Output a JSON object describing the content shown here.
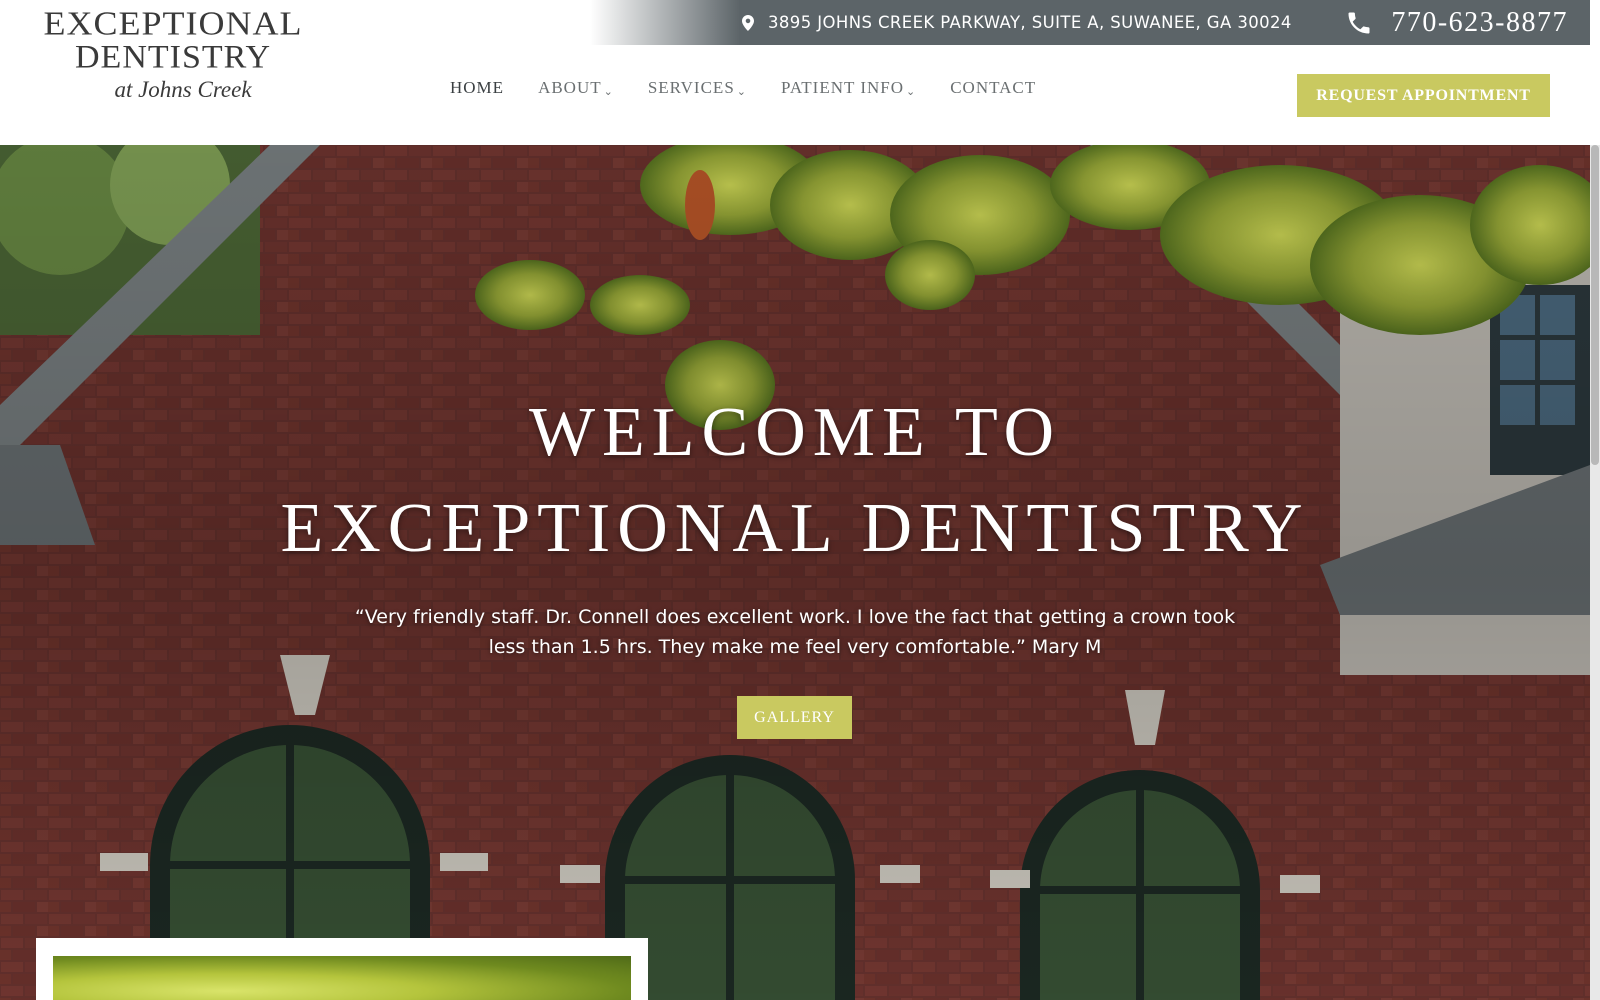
{
  "topbar": {
    "address": "3895 JOHNS CREEK PARKWAY, SUITE A, SUWANEE, GA 30024",
    "phone": "770-623-8877",
    "location_icon": "map-pin-icon",
    "phone_icon": "phone-icon"
  },
  "logo": {
    "line1": "EXCEPTIONAL",
    "line2": "DENTISTRY",
    "line3": "at Johns Creek"
  },
  "nav": {
    "items": [
      {
        "label": "HOME",
        "has_dropdown": false,
        "active": true
      },
      {
        "label": "ABOUT",
        "has_dropdown": true
      },
      {
        "label": "SERVICES",
        "has_dropdown": true
      },
      {
        "label": "PATIENT INFO",
        "has_dropdown": true
      },
      {
        "label": "CONTACT",
        "has_dropdown": false
      }
    ],
    "cta": "REQUEST APPOINTMENT"
  },
  "hero": {
    "title_line1": "WELCOME TO",
    "title_line2": "EXCEPTIONAL DENTISTRY",
    "quote": "“Very friendly staff. Dr. Connell does excellent work. I love the fact that getting a crown took less than 1.5 hrs. They make me feel very comfortable.” Mary M",
    "button": "GALLERY"
  },
  "colors": {
    "accent": "#c9c960",
    "topbar": "#5c6468",
    "nav_text": "#6a6f71",
    "brick": "#6e3530"
  }
}
